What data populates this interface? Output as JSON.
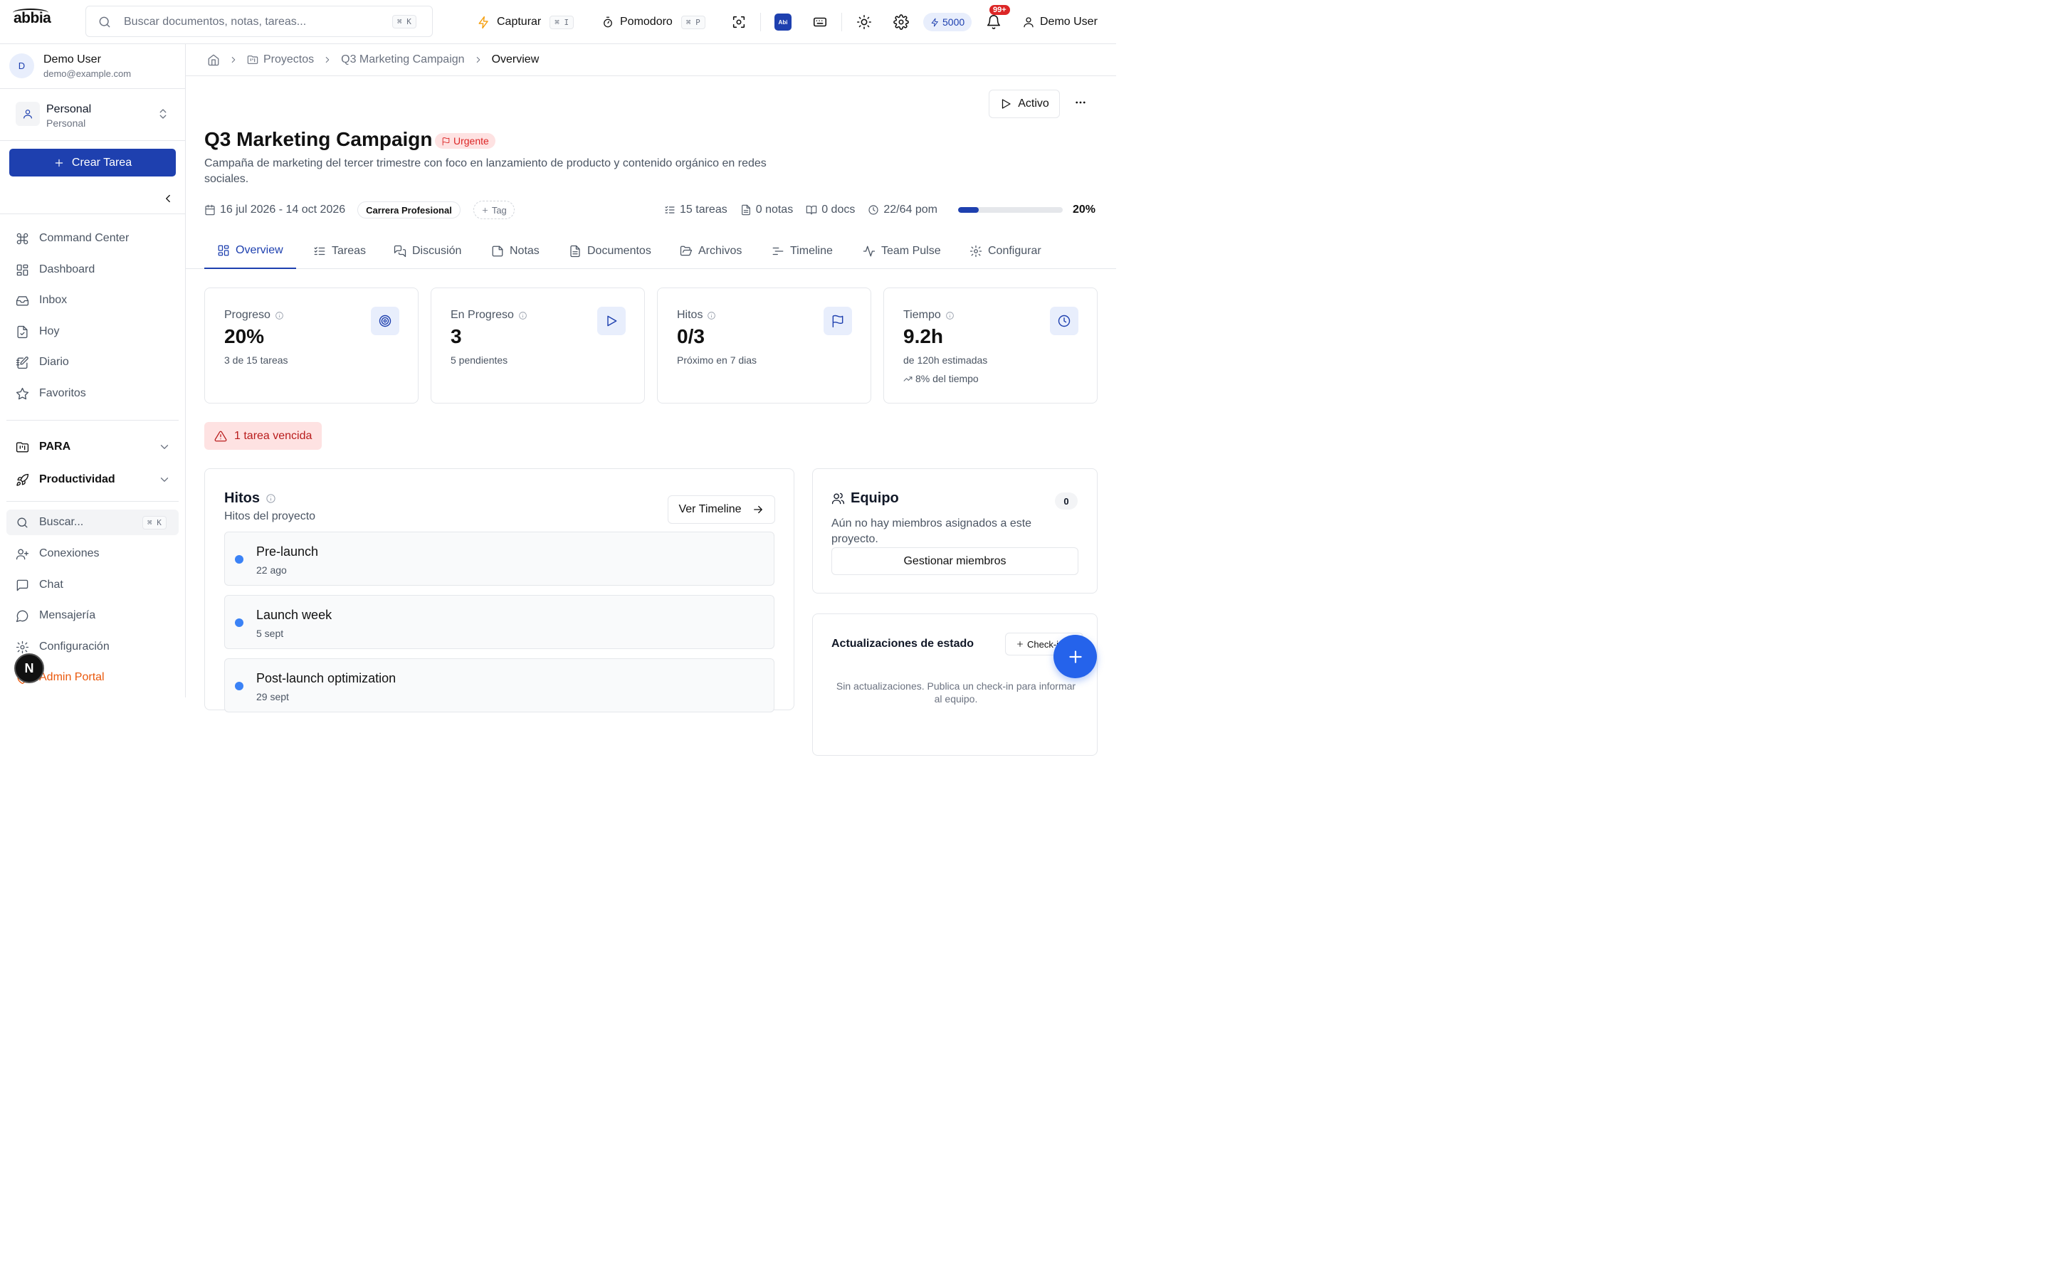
{
  "brand": {
    "logo": "abbia"
  },
  "search": {
    "placeholder": "Buscar documentos, notas, tareas...",
    "shortcut": "⌘ K"
  },
  "topbar": {
    "capture_label": "Capturar",
    "capture_shortcut": "⌘ I",
    "pomodoro_label": "Pomodoro",
    "pomodoro_shortcut": "⌘ P",
    "ai_badge": "Abi",
    "credits": "5000",
    "notifications": "99+",
    "user": "Demo User",
    "accent_color": "#1e40af"
  },
  "sidebar": {
    "user": {
      "initial": "D",
      "name": "Demo User",
      "email": "demo@example.com"
    },
    "workspace": {
      "name": "Personal",
      "subtitle": "Personal"
    },
    "create_label": "Crear Tarea",
    "items": [
      {
        "label": "Command Center",
        "icon": "command-icon"
      },
      {
        "label": "Dashboard",
        "icon": "dashboard-icon"
      },
      {
        "label": "Inbox",
        "icon": "inbox-icon"
      },
      {
        "label": "Hoy",
        "icon": "calendar-file-icon"
      },
      {
        "label": "Diario",
        "icon": "notebook-pen-icon"
      },
      {
        "label": "Favoritos",
        "icon": "star-icon"
      }
    ],
    "groups": [
      {
        "label": "PARA",
        "icon": "folder-kanban-icon"
      },
      {
        "label": "Productividad",
        "icon": "rocket-icon"
      }
    ],
    "search_label": "Buscar...",
    "search_shortcut": "⌘ K",
    "bottom_items": [
      {
        "label": "Conexiones",
        "icon": "user-plus-icon"
      },
      {
        "label": "Chat",
        "icon": "message-square-icon"
      },
      {
        "label": "Mensajería",
        "icon": "message-circle-icon"
      },
      {
        "label": "Configuración",
        "icon": "gear-icon"
      },
      {
        "label": "Admin Portal",
        "icon": "shield-icon"
      }
    ],
    "bubble_letter": "N"
  },
  "breadcrumb": {
    "root": "Proyectos",
    "project": "Q3 Marketing Campaign",
    "current": "Overview"
  },
  "project": {
    "status_label": "Activo",
    "title": "Q3 Marketing Campaign",
    "priority": "Urgente",
    "description": "Campaña de marketing del tercer trimestre con foco en lanzamiento de producto y contenido orgánico en redes sociales.",
    "dates": "16 jul 2026 - 14 oct 2026",
    "tag": "Carrera Profesional",
    "add_tag_label": "Tag",
    "stats": {
      "tasks": "15 tareas",
      "notes": "0 notas",
      "docs": "0 docs",
      "pomodoros": "22/64 pom"
    },
    "progress": 20,
    "progress_label": "20%"
  },
  "tabs": [
    {
      "label": "Overview",
      "icon": "grid-icon",
      "active": true
    },
    {
      "label": "Tareas",
      "icon": "list-check-icon"
    },
    {
      "label": "Discusión",
      "icon": "messages-icon"
    },
    {
      "label": "Notas",
      "icon": "sticky-note-icon"
    },
    {
      "label": "Documentos",
      "icon": "file-text-icon"
    },
    {
      "label": "Archivos",
      "icon": "folder-open-icon"
    },
    {
      "label": "Timeline",
      "icon": "timeline-icon"
    },
    {
      "label": "Team Pulse",
      "icon": "activity-icon"
    },
    {
      "label": "Configurar",
      "icon": "gear-icon"
    }
  ],
  "kpis": [
    {
      "label": "Progreso",
      "value": "20%",
      "sub": "3 de 15 tareas",
      "icon": "target-icon"
    },
    {
      "label": "En Progreso",
      "value": "3",
      "sub": "5 pendientes",
      "icon": "play-icon"
    },
    {
      "label": "Hitos",
      "value": "0/3",
      "sub": "Próximo en 7 dias",
      "icon": "flag-icon"
    },
    {
      "label": "Tiempo",
      "value": "9.2h",
      "sub": "de 120h estimadas",
      "sub2": "8% del tiempo",
      "icon": "clock-icon"
    }
  ],
  "overdue": "1 tarea vencida",
  "milestones": {
    "title": "Hitos",
    "subtitle": "Hitos del proyecto",
    "timeline_button": "Ver Timeline",
    "items": [
      {
        "name": "Pre-launch",
        "date": "22 ago"
      },
      {
        "name": "Launch week",
        "date": "5 sept"
      },
      {
        "name": "Post-launch optimization",
        "date": "29 sept"
      }
    ]
  },
  "team": {
    "title": "Equipo",
    "count": "0",
    "empty": "Aún no hay miembros asignados a este proyecto.",
    "manage_button": "Gestionar miembros"
  },
  "status_updates": {
    "title": "Actualizaciones de estado",
    "checkin_button": "Check-in",
    "empty": "Sin actualizaciones. Publica un check-in para informar al equipo."
  }
}
